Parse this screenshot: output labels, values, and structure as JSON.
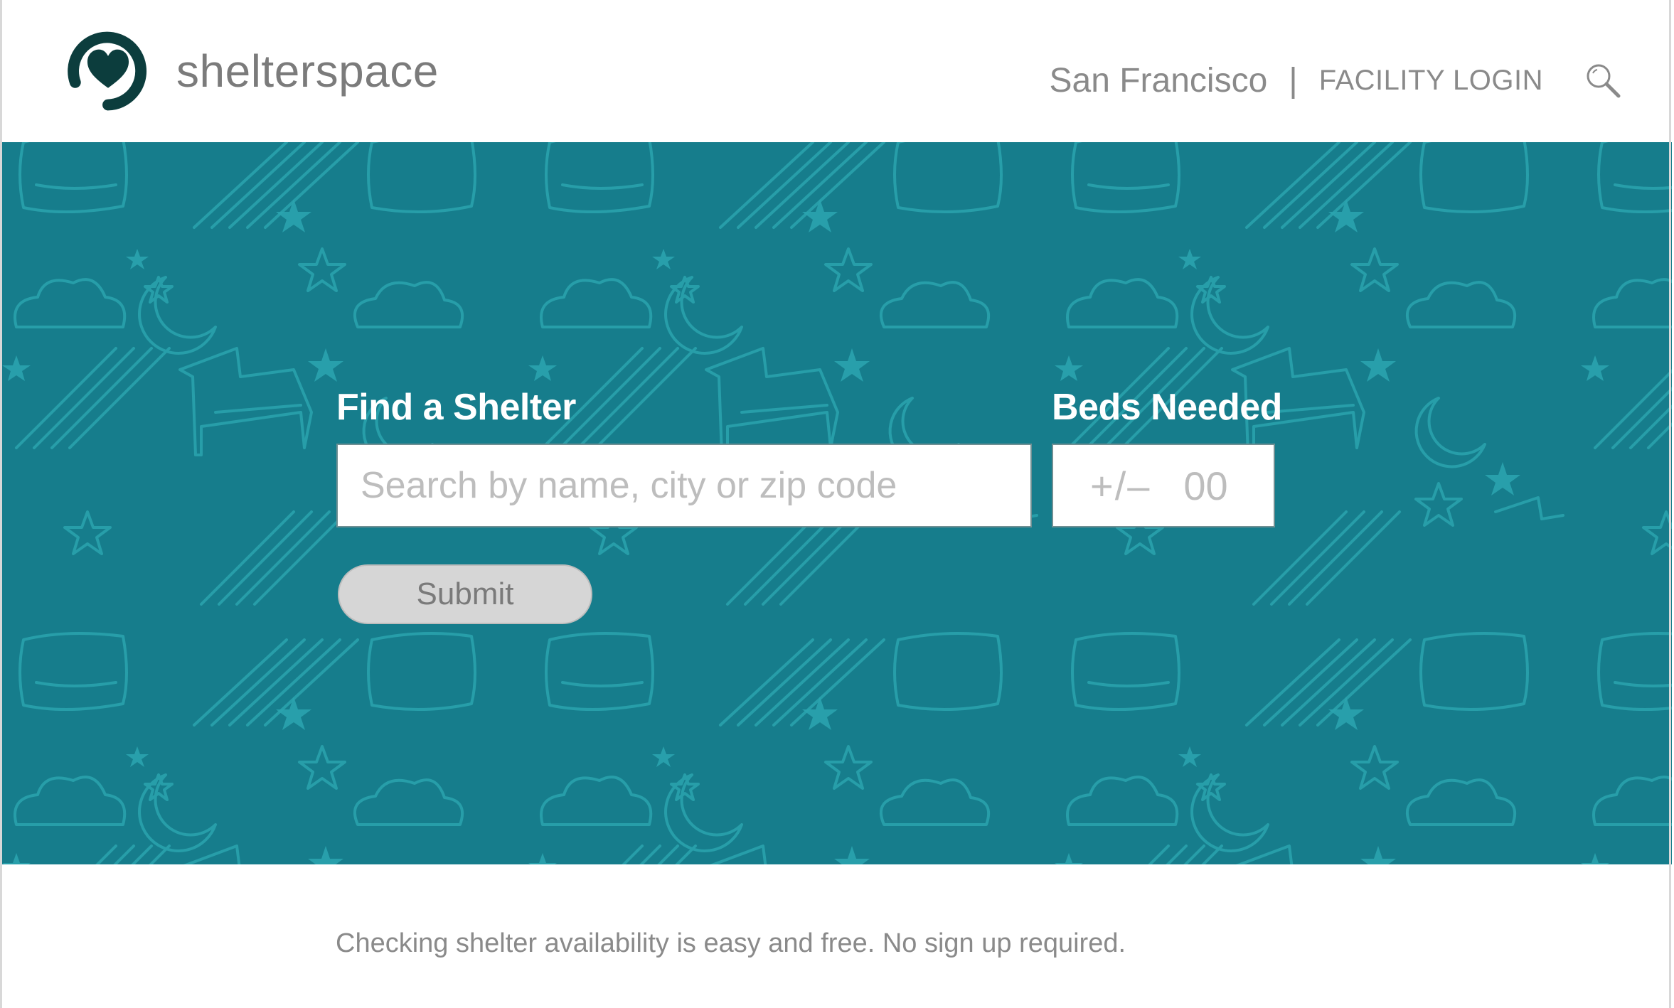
{
  "header": {
    "brand": "shelterspace",
    "logo_icon": "heart-in-circle-logo",
    "city": "San Francisco",
    "separator": "|",
    "facility_login": "FACILITY LOGIN",
    "search_icon": "magnifier-icon"
  },
  "hero": {
    "background_color": "#167d8c",
    "pattern": "beds-pillows-clouds-moons-stars",
    "find_label": "Find a Shelter",
    "search_placeholder": "Search by name, city or zip code",
    "beds_label": "Beds Needed",
    "beds_stepper": "+/–",
    "beds_placeholder": "00",
    "submit_label": "Submit"
  },
  "footer": {
    "tagline": "Checking shelter availability is easy and free. No sign up required."
  },
  "colors": {
    "accent": "#167d8c",
    "logo": "#0c3d3d",
    "text_muted": "#8a8a8a"
  }
}
